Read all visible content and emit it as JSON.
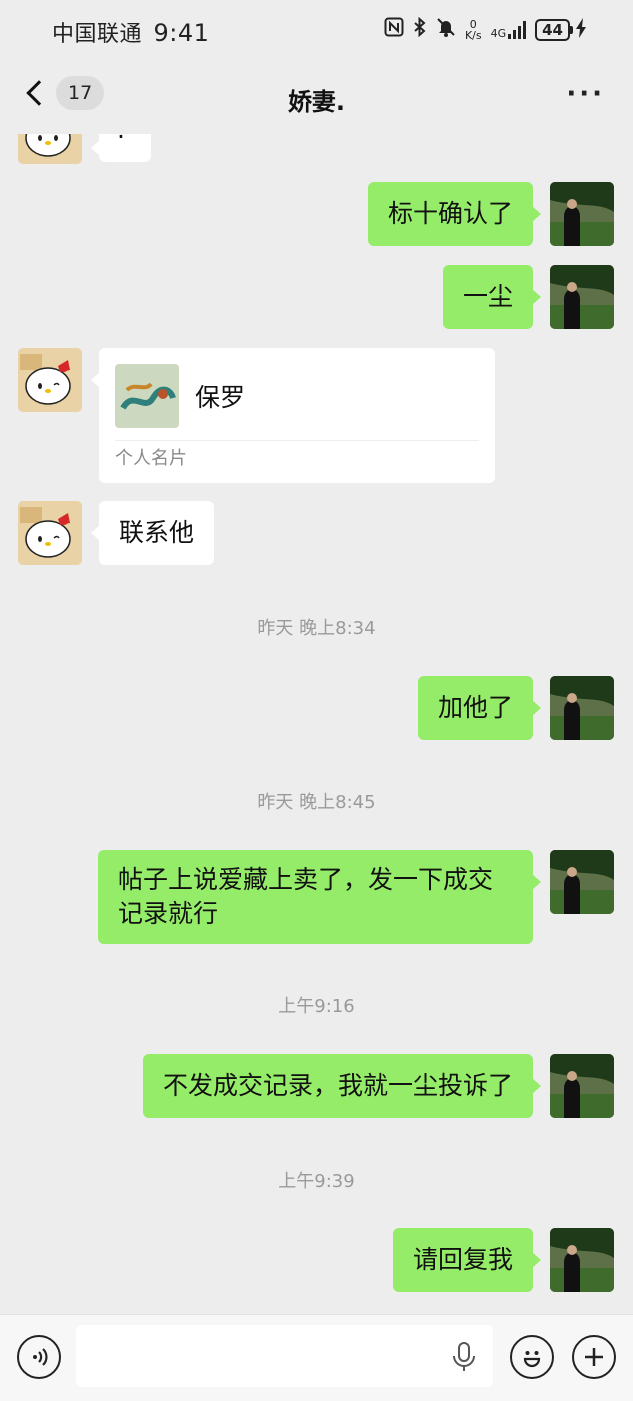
{
  "status_bar": {
    "carrier": "中国联通",
    "time": "9:41",
    "net_speed_value": "0",
    "net_speed_unit": "K/s",
    "net_type": "4G",
    "battery": "44",
    "icons": [
      "nfc-icon",
      "bluetooth-icon",
      "bell-muted-icon",
      "signal-icon",
      "battery-icon",
      "charging-icon"
    ]
  },
  "nav": {
    "unread_count": "17",
    "title": "娇妻.",
    "more_label": "···"
  },
  "messages": [
    {
      "kind": "incoming_text",
      "text": "·",
      "partial": true
    },
    {
      "kind": "outgoing_text",
      "text": "标十确认了"
    },
    {
      "kind": "outgoing_text",
      "text": "一尘"
    },
    {
      "kind": "incoming_card",
      "card_name": "保罗",
      "card_label": "个人名片"
    },
    {
      "kind": "incoming_text",
      "text": "联系他"
    },
    {
      "kind": "timestamp",
      "text": "昨天 晚上8:34"
    },
    {
      "kind": "outgoing_text",
      "text": "加他了"
    },
    {
      "kind": "timestamp",
      "text": "昨天 晚上8:45"
    },
    {
      "kind": "outgoing_text",
      "text": "帖子上说爱藏上卖了，发一下成交记录就行"
    },
    {
      "kind": "timestamp",
      "text": "上午9:16"
    },
    {
      "kind": "outgoing_text",
      "text": "不发成交记录，我就一尘投诉了"
    },
    {
      "kind": "timestamp",
      "text": "上午9:39"
    },
    {
      "kind": "outgoing_text",
      "text": "请回复我"
    }
  ],
  "input_bar": {
    "placeholder": "",
    "icons": [
      "voice-icon",
      "microphone-icon",
      "emoji-icon",
      "plus-icon"
    ]
  },
  "colors": {
    "background": "#ededed",
    "outgoing_bubble": "#95ec69",
    "incoming_bubble": "#ffffff",
    "timestamp_text": "#9a9a9a"
  }
}
